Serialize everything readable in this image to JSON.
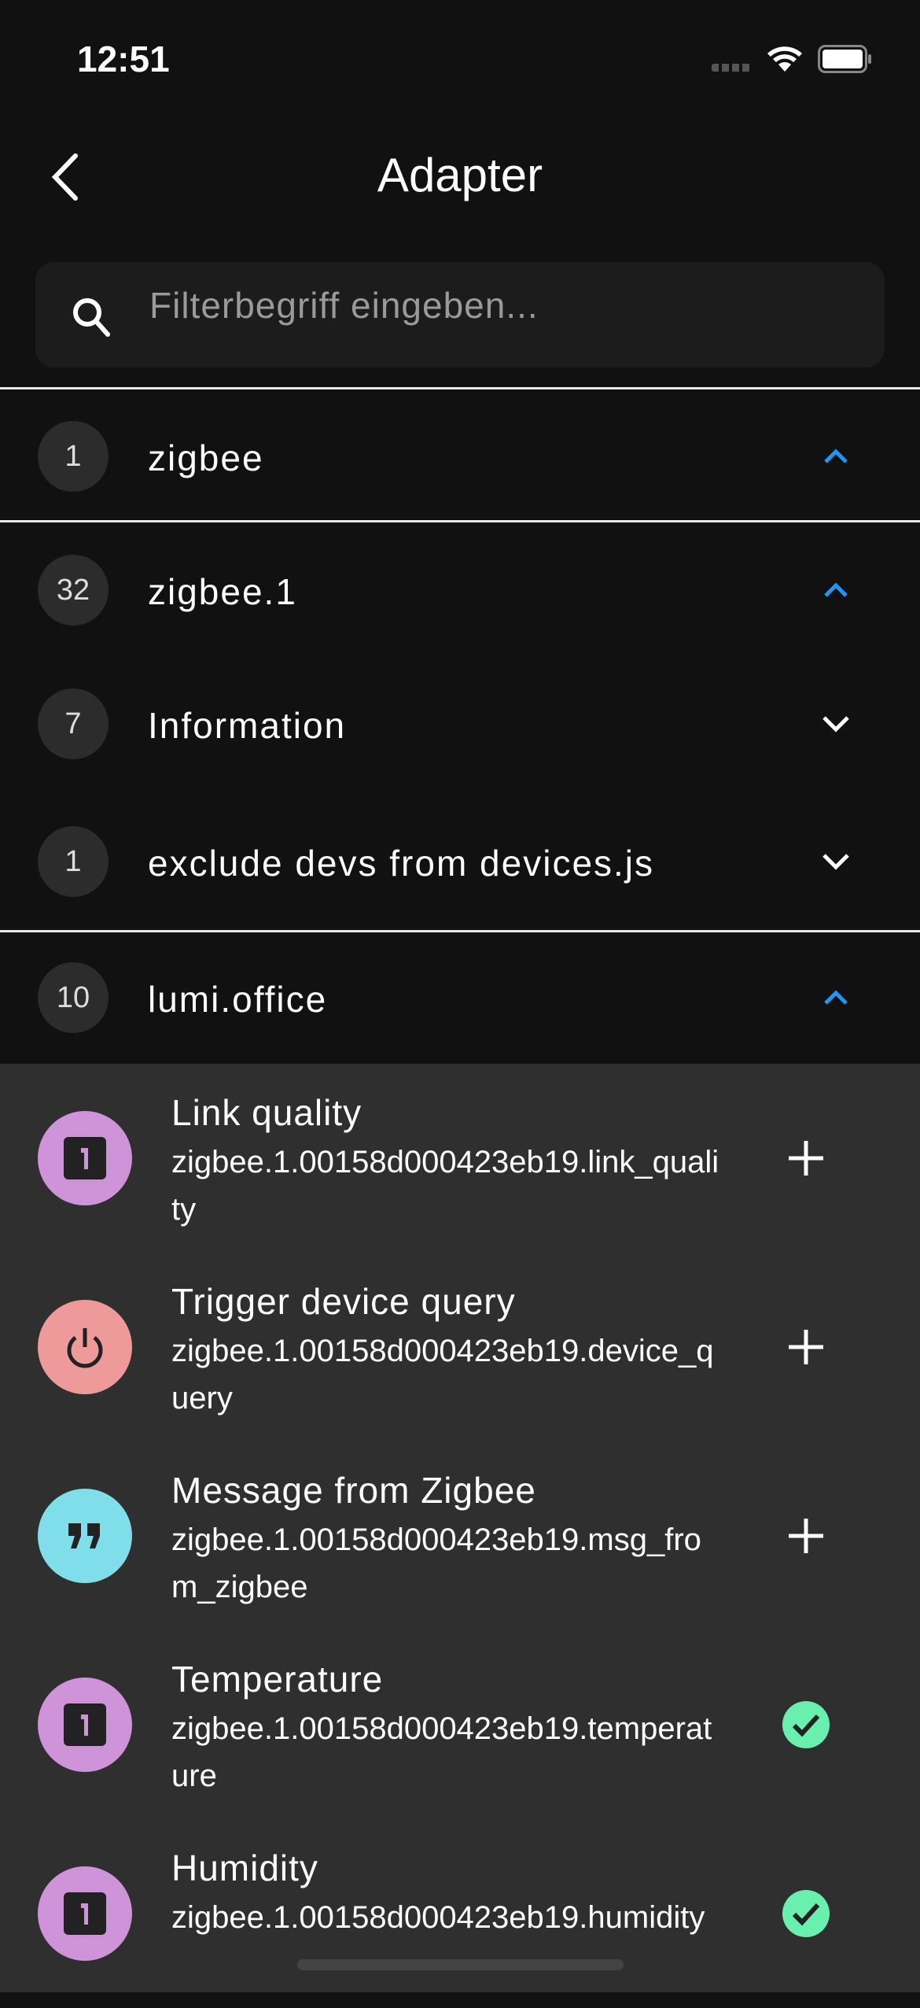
{
  "status": {
    "time": "12:51"
  },
  "header": {
    "title": "Adapter"
  },
  "search": {
    "placeholder": "Filterbegriff eingeben..."
  },
  "groups": [
    {
      "count": "1",
      "label": "zigbee",
      "state": "expanded"
    },
    {
      "count": "32",
      "label": "zigbee.1",
      "state": "expanded"
    },
    {
      "count": "7",
      "label": "Information",
      "state": "collapsed"
    },
    {
      "count": "1",
      "label": "exclude devs from devices.js",
      "state": "collapsed"
    },
    {
      "count": "10",
      "label": "lumi.office",
      "state": "expanded"
    }
  ],
  "items": [
    {
      "title": "Link quality",
      "path": "zigbee.1.00158d000423eb19.link_quality",
      "icon": "number-icon",
      "color": "#ce93d8",
      "action": "add"
    },
    {
      "title": "Trigger device query",
      "path": "zigbee.1.00158d000423eb19.device_query",
      "icon": "power-icon",
      "color": "#ef9a9a",
      "action": "add"
    },
    {
      "title": "Message from Zigbee",
      "path": "zigbee.1.00158d000423eb19.msg_from_zigbee",
      "icon": "quote-icon",
      "color": "#80deea",
      "action": "add"
    },
    {
      "title": "Temperature",
      "path": "zigbee.1.00158d000423eb19.temperature",
      "icon": "number-icon",
      "color": "#ce93d8",
      "action": "added"
    },
    {
      "title": "Humidity",
      "path": "zigbee.1.00158d000423eb19.humidity",
      "icon": "number-icon",
      "color": "#ce93d8",
      "action": "added"
    }
  ],
  "colors": {
    "accent": "#2196f3",
    "check": "#69f0ae"
  }
}
